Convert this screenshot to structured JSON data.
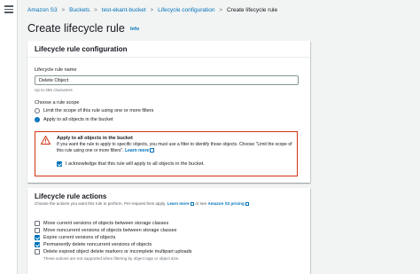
{
  "breadcrumb": {
    "items": [
      "Amazon S3",
      "Buckets",
      "test-ekant-bucket",
      "Lifecycle configuration"
    ],
    "current": "Create lifecycle rule",
    "separator": ">"
  },
  "page": {
    "title": "Create lifecycle rule",
    "info_label": "Info"
  },
  "config_panel": {
    "heading": "Lifecycle rule configuration",
    "name_label": "Lifecycle rule name",
    "name_value": "Delete Object",
    "name_hint": "Up to 255 characters",
    "scope_label": "Choose a rule scope",
    "scope_options": [
      {
        "label": "Limit the scope of this rule using one or more filters",
        "selected": false
      },
      {
        "label": "Apply to all objects in the bucket",
        "selected": true
      }
    ],
    "alert": {
      "title": "Apply to all objects in the bucket",
      "body": "If you want the rule to apply to specific objects, you must use a filter to identify those objects. Choose \"Limit the scope of this rule using one or more filters\".",
      "link": "Learn more",
      "ack_label": "I acknowledge that this rule will apply to all objects in the bucket.",
      "ack_checked": true,
      "color": "#d13212"
    }
  },
  "actions_panel": {
    "heading": "Lifecycle rule actions",
    "description_prefix": "Choose the actions you want this rule to perform. Per-request fees apply.",
    "learn_more": "Learn more",
    "or_text": "or see",
    "pricing_link": "Amazon S3 pricing",
    "options": [
      {
        "label": "Move current versions of objects between storage classes",
        "checked": false
      },
      {
        "label": "Move noncurrent versions of objects between storage classes",
        "checked": false
      },
      {
        "label": "Expire current versions of objects",
        "checked": true
      },
      {
        "label": "Permanently delete noncurrent versions of objects",
        "checked": true
      },
      {
        "label": "Delete expired object delete markers or incomplete multipart uploads",
        "checked": false
      }
    ],
    "options_hint": "These actions are not supported when filtering by object tags or object size."
  },
  "colors": {
    "link": "#0073bb",
    "background": "#f2f3f3",
    "warning": "#d13212"
  }
}
